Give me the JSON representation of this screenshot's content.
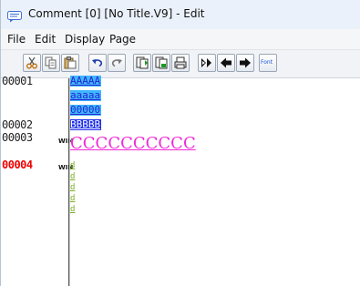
{
  "window": {
    "title": "Comment [0] [No Title.V9] - Edit"
  },
  "menu": [
    "File",
    "Edit",
    "Display",
    "Page"
  ],
  "toolbar": {
    "buttons": [
      "cut-icon",
      "copy-icon",
      "paste-icon",
      "undo-icon",
      "redo-icon",
      "page-add-icon",
      "page-copy-icon",
      "print-icon",
      "jump-icon",
      "back-arrow-icon",
      "forward-arrow-icon",
      "font-icon"
    ],
    "font_label": "Font"
  },
  "lines": [
    {
      "number": "00001",
      "win": "",
      "texts": [
        "AAAAA",
        "aaaaa",
        "00000"
      ]
    },
    {
      "number": "00002",
      "win": "",
      "texts": [
        "BBBBB"
      ]
    },
    {
      "number": "00003",
      "win": "WIN",
      "texts": [
        "CCCCCCCCCC"
      ]
    },
    {
      "number": "00004",
      "win": "WIN",
      "texts": [
        "d",
        "d",
        "d",
        "d",
        "d"
      ]
    }
  ],
  "colors": {
    "highlight": "#3fb6ff",
    "highlight_dark": "#1f30e8",
    "pink": "#f02ad8",
    "green": "#79b21f",
    "current_line_number": "#ee0000"
  }
}
